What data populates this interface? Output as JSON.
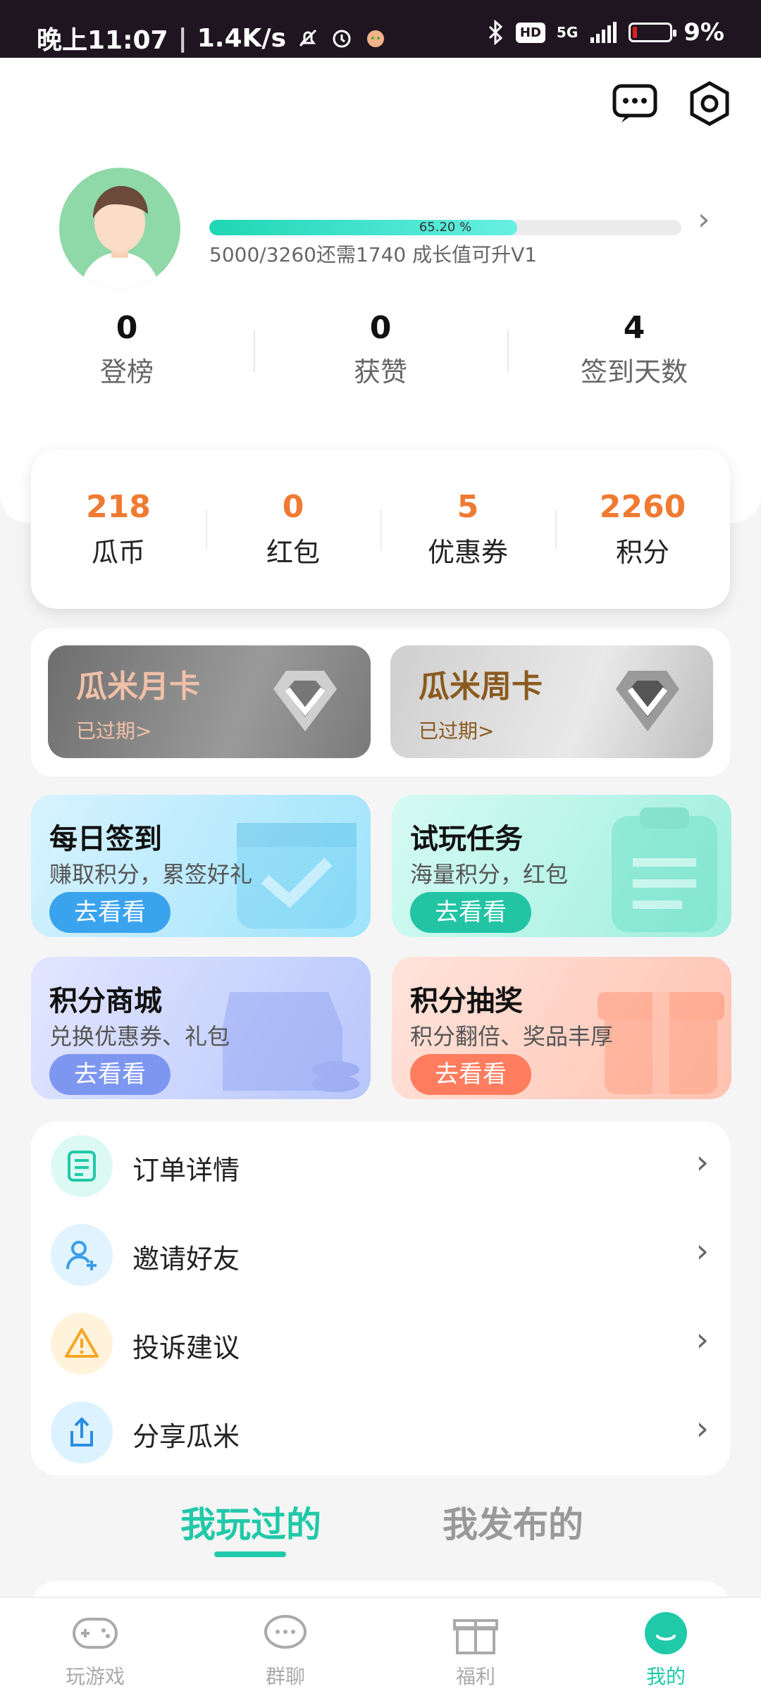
{
  "status_bar": {
    "time": "晚上11:07",
    "speed": "1.4K/s",
    "network": "5G",
    "hd": "HD",
    "battery": "9%"
  },
  "profile": {
    "progress_text": "65.20 %",
    "progress_fraction": 0.652,
    "level_desc": "5000/3260还需1740 成长值可升V1"
  },
  "stats": [
    {
      "value": "0",
      "label": "登榜"
    },
    {
      "value": "0",
      "label": "获赞"
    },
    {
      "value": "4",
      "label": "签到天数"
    }
  ],
  "wallet": [
    {
      "value": "218",
      "label": "瓜币"
    },
    {
      "value": "0",
      "label": "红包"
    },
    {
      "value": "5",
      "label": "优惠券"
    },
    {
      "value": "2260",
      "label": "积分"
    }
  ],
  "vip_cards": [
    {
      "title": "瓜米月卡",
      "status": "已过期>"
    },
    {
      "title": "瓜米周卡",
      "status": "已过期>"
    }
  ],
  "tasks": [
    {
      "title": "每日签到",
      "subtitle": "赚取积分，累签好礼",
      "button": "去看看"
    },
    {
      "title": "试玩任务",
      "subtitle": "海量积分，红包",
      "button": "去看看"
    },
    {
      "title": "积分商城",
      "subtitle": "兑换优惠券、礼包",
      "button": "去看看"
    },
    {
      "title": "积分抽奖",
      "subtitle": "积分翻倍、奖品丰厚",
      "button": "去看看"
    }
  ],
  "menu": [
    {
      "label": "订单详情",
      "icon": "order-icon"
    },
    {
      "label": "邀请好友",
      "icon": "invite-icon"
    },
    {
      "label": "投诉建议",
      "icon": "warning-icon"
    },
    {
      "label": "分享瓜米",
      "icon": "share-icon"
    }
  ],
  "tabs": [
    {
      "label": "我玩过的",
      "active": true
    },
    {
      "label": "我发布的",
      "active": false
    }
  ],
  "bottom_nav": [
    {
      "label": "玩游戏",
      "icon": "gamepad-icon"
    },
    {
      "label": "群聊",
      "icon": "chat-icon"
    },
    {
      "label": "福利",
      "icon": "gift-icon"
    },
    {
      "label": "我的",
      "icon": "profile-icon",
      "active": true
    }
  ],
  "colors": {
    "accent": "#20c9a8",
    "orange": "#f07a32",
    "status_bar": "#1f1520"
  }
}
